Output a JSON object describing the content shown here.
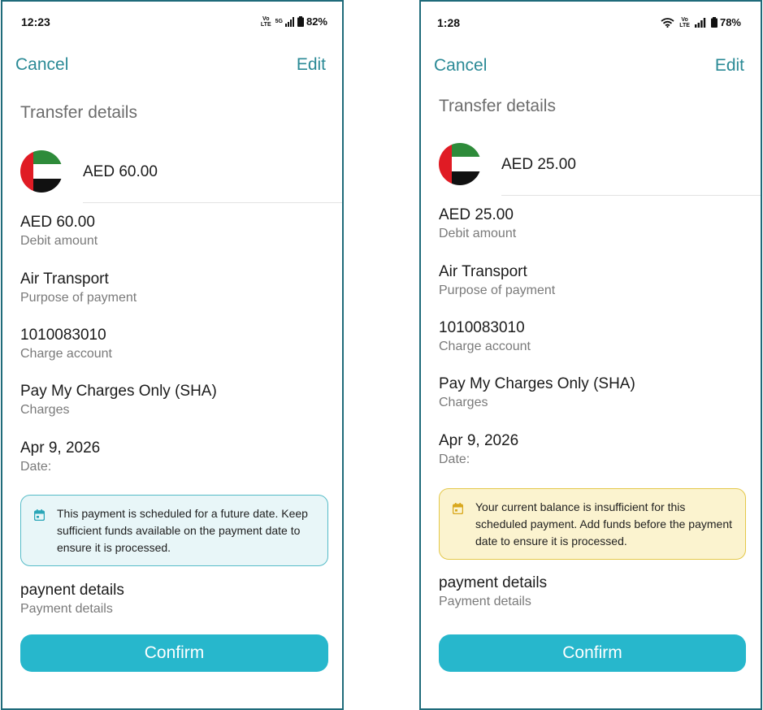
{
  "left": {
    "status": {
      "time": "12:23",
      "network": "5G",
      "battery": "82%"
    },
    "nav": {
      "cancel": "Cancel",
      "edit": "Edit"
    },
    "title": "Transfer details",
    "header_amount": "AED 60.00",
    "fields": [
      {
        "value": "AED 60.00",
        "label": "Debit amount"
      },
      {
        "value": "Air Transport",
        "label": "Purpose of payment"
      },
      {
        "value": "1010083010",
        "label": "Charge account"
      },
      {
        "value": "Pay My Charges Only (SHA)",
        "label": "Charges"
      },
      {
        "value": "Apr 9, 2026",
        "label": "Date:"
      }
    ],
    "notice": {
      "type": "info",
      "icon": "calendar-icon",
      "text": "This payment is scheduled for a future date. Keep sufficient funds available on the payment date to ensure it is processed."
    },
    "details": {
      "value": "paynent details",
      "label": "Payment details"
    },
    "confirm": "Confirm"
  },
  "right": {
    "status": {
      "time": "1:28",
      "battery": "78%"
    },
    "nav": {
      "cancel": "Cancel",
      "edit": "Edit"
    },
    "title": "Transfer details",
    "header_amount": "AED 25.00",
    "fields": [
      {
        "value": "AED 25.00",
        "label": "Debit amount"
      },
      {
        "value": "Air Transport",
        "label": "Purpose of payment"
      },
      {
        "value": "1010083010",
        "label": "Charge account"
      },
      {
        "value": "Pay My Charges Only (SHA)",
        "label": "Charges"
      },
      {
        "value": "Apr 9, 2026",
        "label": "Date:"
      }
    ],
    "notice": {
      "type": "warning",
      "icon": "calendar-icon",
      "text": "Your current balance is insufficient for this scheduled payment. Add funds before the payment date to ensure it is processed."
    },
    "details": {
      "value": "payment details",
      "label": "Payment details"
    },
    "confirm": "Confirm"
  },
  "colors": {
    "accent": "#2b8a96",
    "button": "#27b7cc",
    "frame_border": "#1f6b7a",
    "info_bg": "#e8f6f8",
    "info_border": "#56bcc8",
    "warning_bg": "#fbf3cf",
    "warning_border": "#e4c84a"
  }
}
